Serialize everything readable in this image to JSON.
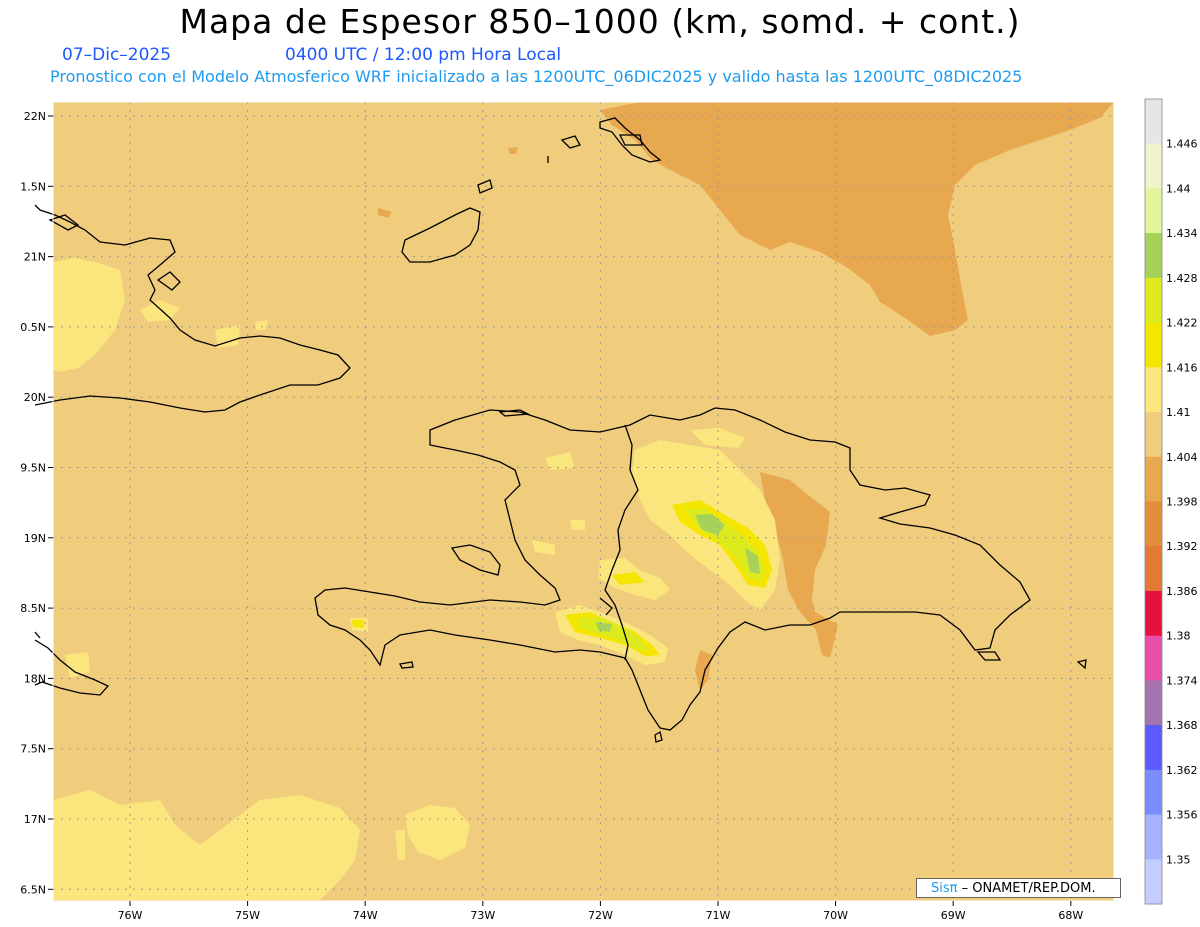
{
  "header": {
    "title": "Mapa de Espesor 850–1000 (km, somd. + cont.)",
    "date": "07–Dic–2025",
    "valid_time": "0400 UTC / 12:00 pm Hora Local",
    "forecast_info": "Pronostico con el Modelo Atmosferico WRF inicializado a las 1200UTC_06DIC2025 y valido hasta las  1200UTC_08DIC2025"
  },
  "credit": {
    "brand": "Sisπ",
    "text": " – ONAMET/REP.DOM."
  },
  "map": {
    "lat_labels": [
      "22N",
      "1.5N",
      "21N",
      "0.5N",
      "20N",
      "9.5N",
      "19N",
      "8.5N",
      "18N",
      "7.5N",
      "17N",
      "6.5N"
    ],
    "lon_labels": [
      "76W",
      "75W",
      "74W",
      "73W",
      "72W",
      "71W",
      "70W",
      "69W",
      "68W"
    ],
    "background_color": "#f0cc7d",
    "coast_color": "#000000"
  },
  "colorbar": {
    "labels": [
      "1.446",
      "1.44",
      "1.434",
      "1.428",
      "1.422",
      "1.416",
      "1.41",
      "1.404",
      "1.398",
      "1.392",
      "1.386",
      "1.38",
      "1.374",
      "1.368",
      "1.362",
      "1.356",
      "1.35"
    ],
    "colors": [
      "#e6e6e6",
      "#f2f5cc",
      "#e3f59b",
      "#a6d25a",
      "#dcea1e",
      "#f4e600",
      "#fbe67d",
      "#f0cc7d",
      "#e8a850",
      "#e38d3d",
      "#e07a35",
      "#e8103c",
      "#ea4fa8",
      "#a573ae",
      "#5a5aff",
      "#7a8cff",
      "#a6b4ff",
      "#c3cdff"
    ]
  }
}
